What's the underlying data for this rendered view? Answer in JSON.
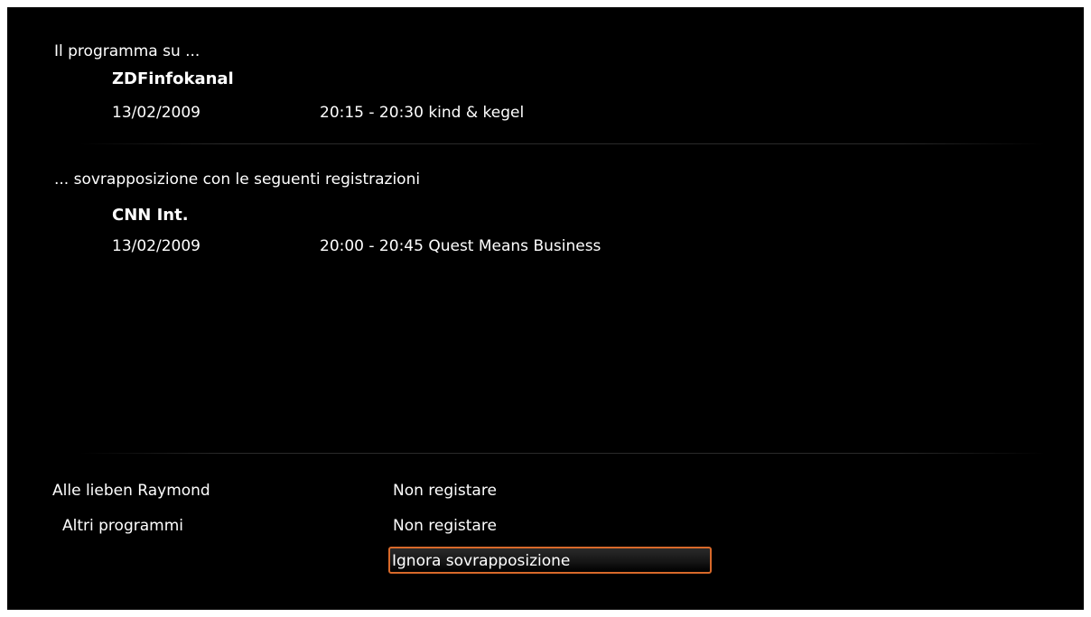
{
  "heading": "Il programma su ...",
  "new_recording": {
    "channel": "ZDFinfokanal",
    "date": "13/02/2009",
    "time_title": "20:15 - 20:30 kind & kegel"
  },
  "conflict_heading": "... sovrapposizione con le seguenti registrazioni",
  "conflicts": [
    {
      "channel": "CNN Int.",
      "date": "13/02/2009",
      "time_title": "20:00 - 20:45 Quest Means Business"
    }
  ],
  "options": [
    {
      "label": "Alle lieben Raymond",
      "value": "Non registare"
    },
    {
      "label": "Altri programmi",
      "value": "Non registare"
    }
  ],
  "ignore_button": "Ignora sovrapposizione",
  "colors": {
    "background": "#000000",
    "text": "#ffffff",
    "focus_border": "#d8692a"
  }
}
